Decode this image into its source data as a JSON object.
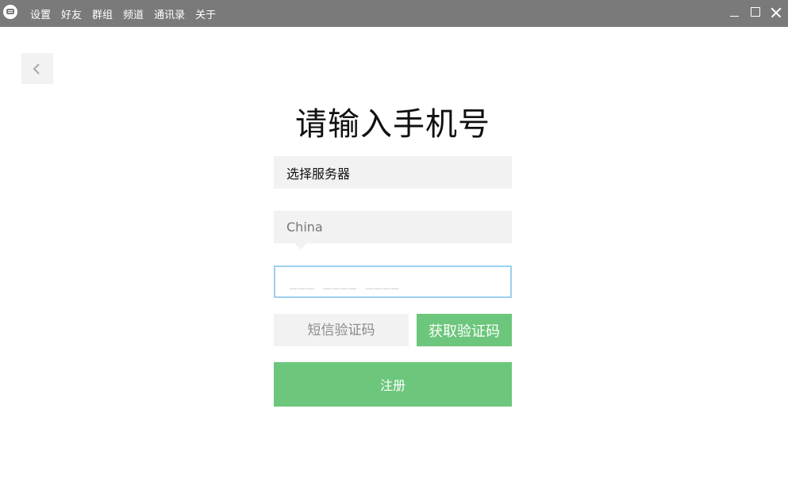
{
  "titlebar": {
    "menu": [
      {
        "label": "设置"
      },
      {
        "label": "好友"
      },
      {
        "label": "群组"
      },
      {
        "label": "频道"
      },
      {
        "label": "通讯录"
      },
      {
        "label": "关于"
      }
    ],
    "color": "#7a7a7a"
  },
  "page": {
    "title": "请输入手机号",
    "server_select": "选择服务器",
    "country_select": "China",
    "phone_placeholder": "___ ____ ____",
    "sms_placeholder": "短信验证码",
    "get_code_label": "获取验证码",
    "register_label": "注册"
  },
  "icons": {
    "back": "chevron-left-icon",
    "logo": "chat-bubble-icon"
  },
  "colors": {
    "accent": "#6cc67b",
    "input_focus_border": "#9ccfee",
    "field_bg": "#f2f2f2"
  }
}
